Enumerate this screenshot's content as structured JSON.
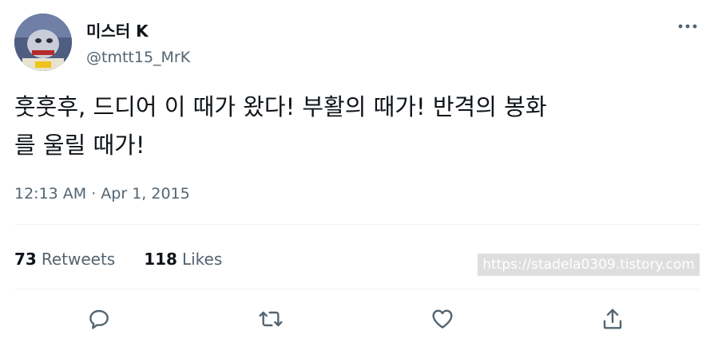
{
  "user": {
    "display_name": "미스터 K",
    "handle": "@tmtt15_MrK"
  },
  "tweet": {
    "text_line1": "훗훗후, 드디어 이 때가 왔다! 부활의 때가! 반격의 봉화",
    "text_line2": "를 울릴 때가!",
    "timestamp": "12:13 AM · Apr 1, 2015"
  },
  "stats": {
    "retweets_count": "73",
    "retweets_label": "Retweets",
    "likes_count": "118",
    "likes_label": "Likes"
  },
  "watermark": "https://stadela0309.tistory.com",
  "actions": [
    "reply-icon",
    "retweet-icon",
    "like-icon",
    "share-icon"
  ],
  "colors": {
    "text": "#0f1419",
    "secondary": "#536471",
    "divider": "#eff3f4",
    "icon": "#536471"
  }
}
